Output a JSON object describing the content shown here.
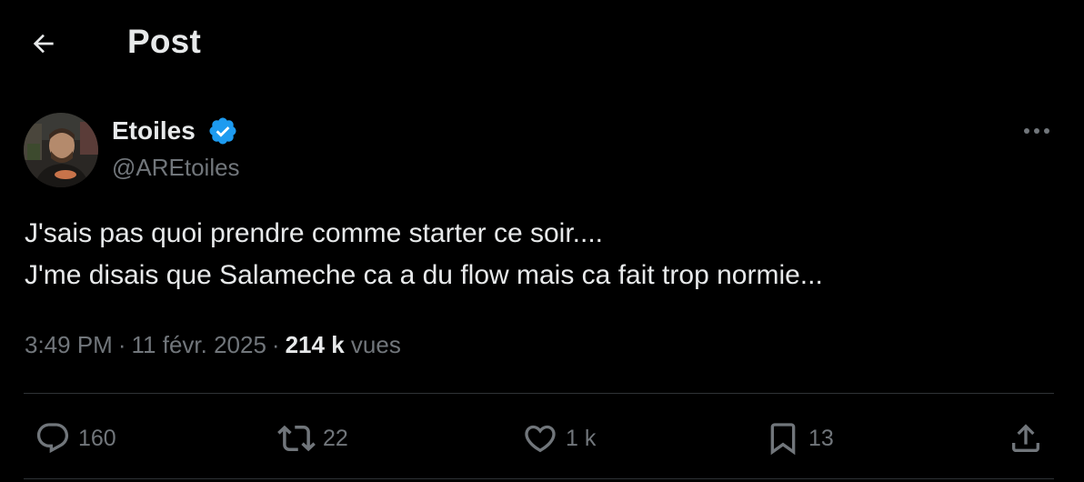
{
  "header": {
    "title": "Post"
  },
  "author": {
    "display_name": "Etoiles",
    "handle": "@AREtoiles",
    "verified": true
  },
  "tweet": {
    "lines": [
      "J'sais pas quoi prendre comme starter ce soir....",
      "J'me disais que Salameche ca a du flow mais ca fait trop normie..."
    ]
  },
  "meta": {
    "time": "3:49 PM",
    "separator": "·",
    "date": "11 févr. 2025",
    "views_count": "214 k",
    "views_label": "vues"
  },
  "actions": {
    "replies": "160",
    "reposts": "22",
    "likes": "1 k",
    "bookmarks": "13"
  },
  "colors": {
    "background": "#000000",
    "text_primary": "#e7e9ea",
    "text_secondary": "#71767b",
    "divider": "#2f3336",
    "verified": "#1d9bf0"
  },
  "icons": {
    "back": "arrow-left-icon",
    "verified": "verified-badge-icon",
    "more": "more-horizontal-icon",
    "reply": "reply-icon",
    "repost": "repost-icon",
    "like": "heart-icon",
    "bookmark": "bookmark-icon",
    "share": "share-icon"
  }
}
